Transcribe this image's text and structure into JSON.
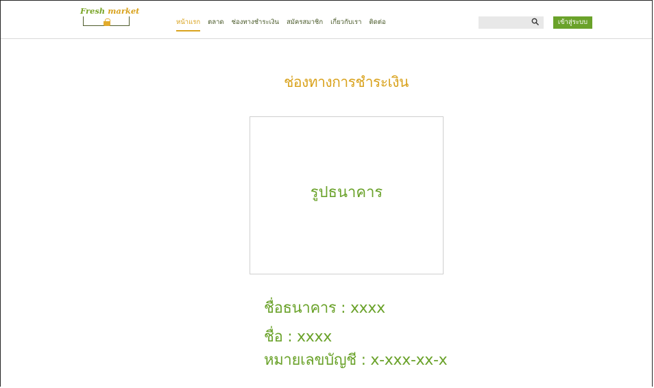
{
  "header": {
    "logo_fresh": "Fresh",
    "logo_market": "market",
    "nav": [
      {
        "label": "หน้าแรก",
        "active": true
      },
      {
        "label": "ตลาด",
        "active": false
      },
      {
        "label": "ช่องทางชำระเงิน",
        "active": false
      },
      {
        "label": "สมัครสมาชิก",
        "active": false
      },
      {
        "label": "เกี่ยวกับเรา",
        "active": false
      },
      {
        "label": "ติดต่อ",
        "active": false
      }
    ],
    "search_placeholder": "",
    "search_icon": "magnifier-icon",
    "login_label": "เข้าสู่ระบบ"
  },
  "main": {
    "title": "ช่องทางการชำระเงิน",
    "image_label": "รูปธนาคาร",
    "bank_name": "ชื่อธนาคาร : xxxx",
    "account_name": "ชื่อ : xxxx",
    "account_number": "หมายเลขบัญชี : x-xxx-xx-x"
  },
  "colors": {
    "accent_green": "#6aa22a",
    "accent_gold": "#d9a21c",
    "nav_text": "#4a5a2a"
  }
}
